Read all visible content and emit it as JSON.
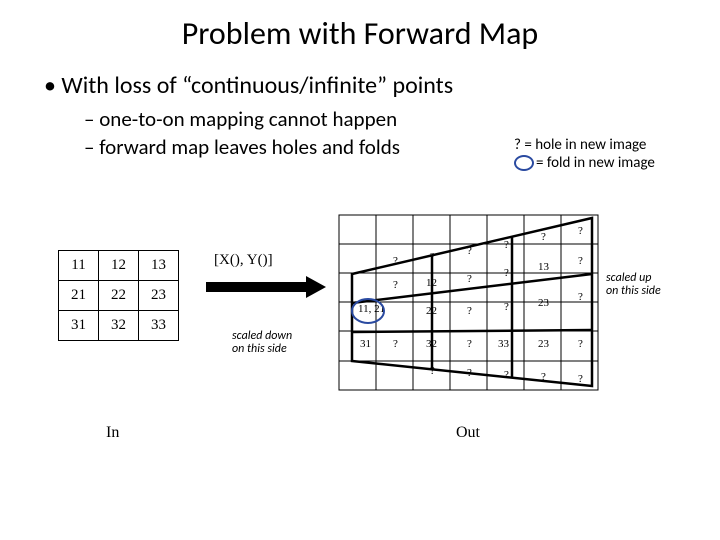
{
  "title": "Problem with Forward Map",
  "bullets": {
    "l1": "With loss of “continuous/infinite” points",
    "l2a": "one-to-on mapping cannot happen",
    "l2b": "forward map leaves holes and folds"
  },
  "legend": {
    "hole": "? = hole in new image",
    "fold_suffix": "= fold in new image"
  },
  "diagram": {
    "map_label": "[X(), Y()]",
    "anno_down_l1": "scaled down",
    "anno_down_l2": "on this side",
    "anno_up_l1": "scaled up",
    "anno_up_l2": "on this side",
    "in_label": "In",
    "out_label": "Out",
    "in_grid": [
      [
        "11",
        "12",
        "13"
      ],
      [
        "21",
        "22",
        "23"
      ],
      [
        "31",
        "32",
        "33"
      ]
    ],
    "out_cells": {
      "q": "?",
      "c12": "12",
      "c13": "13",
      "c11_21": "11, 21",
      "c22": "22",
      "c23": "23",
      "c31": "31",
      "c32": "32",
      "c33": "33",
      "c23b": "23"
    }
  }
}
